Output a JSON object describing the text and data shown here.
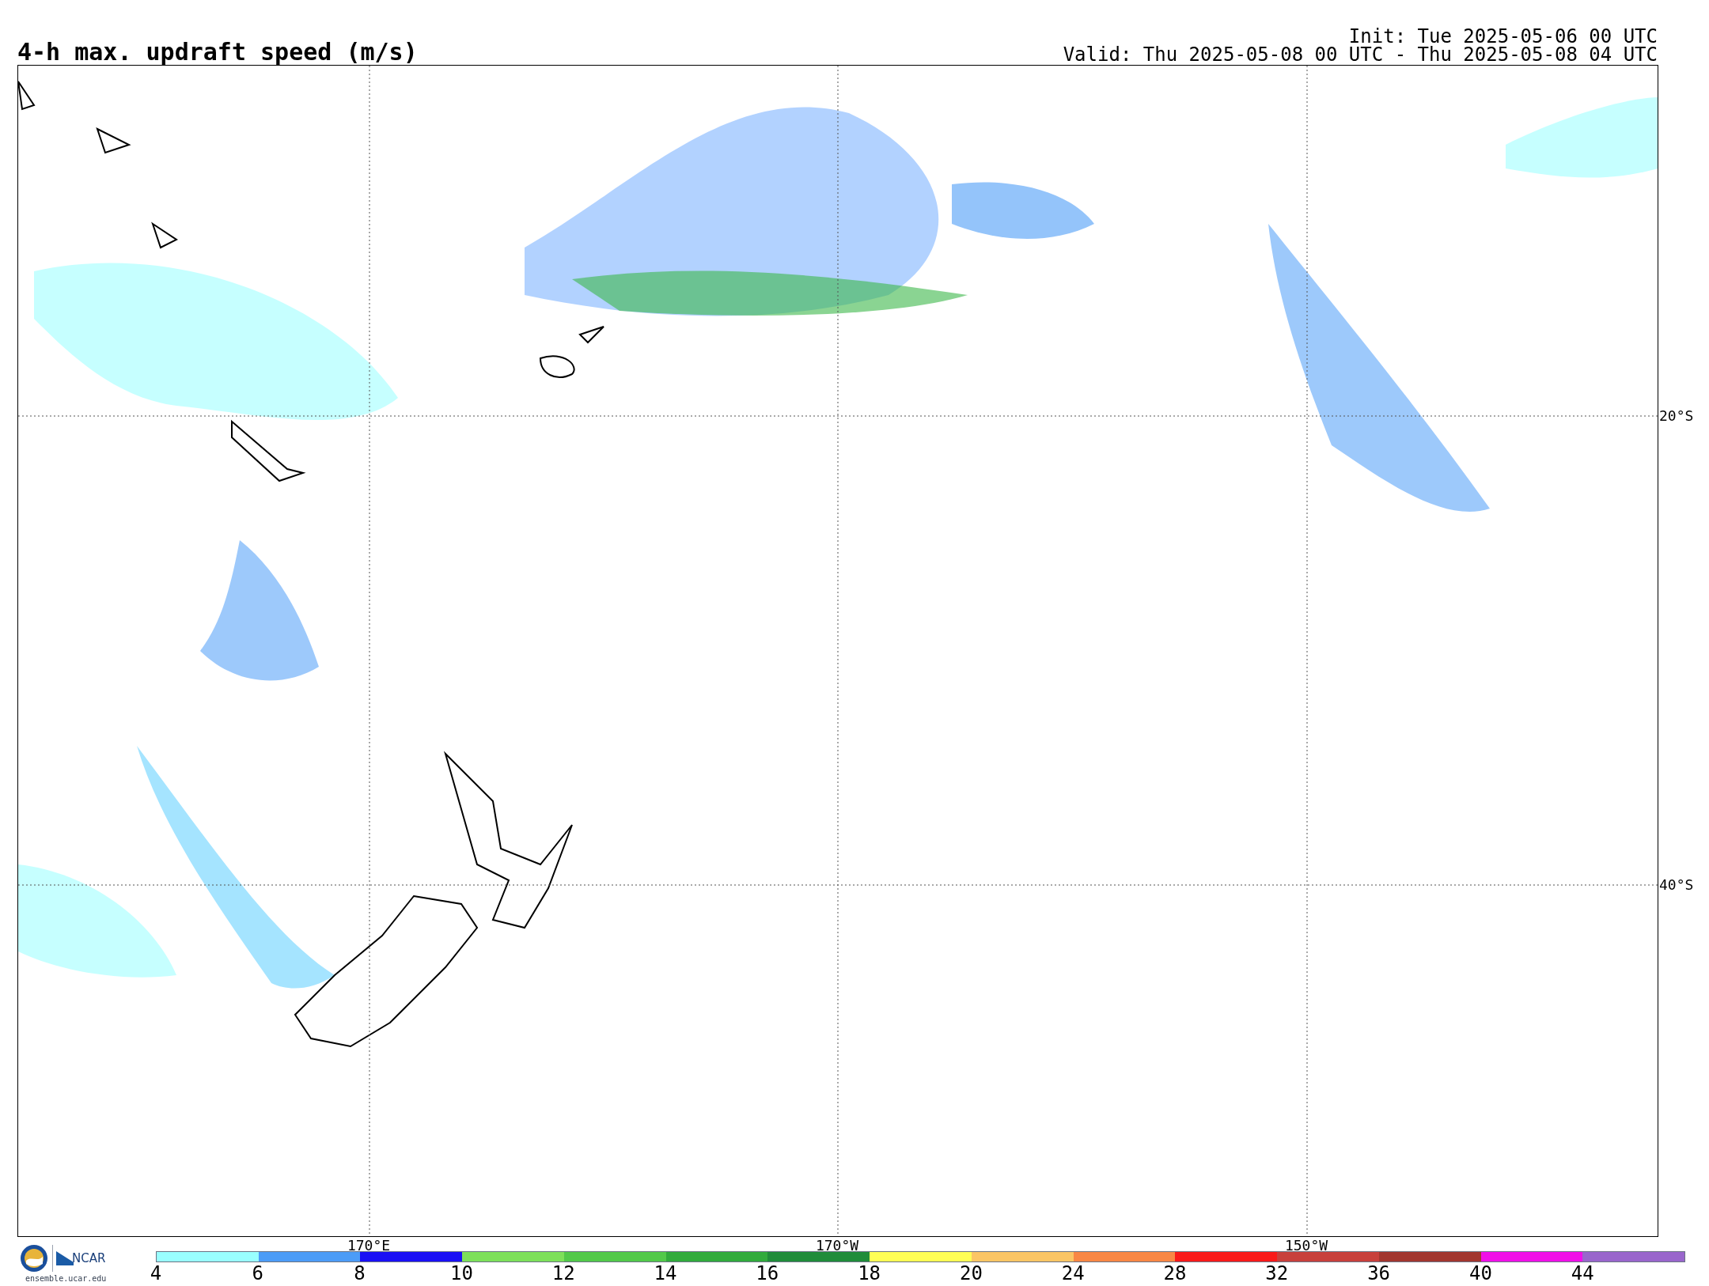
{
  "title": "4-h max. updraft speed (m/s)",
  "init": "Init: Tue 2025-05-06 00 UTC",
  "valid": "Valid: Thu 2025-05-08 00 UTC - Thu 2025-05-08 04 UTC",
  "map": {
    "lat_labels": [
      "20°S",
      "40°S"
    ],
    "lon_labels": [
      "170°E",
      "170°W",
      "150°W"
    ]
  },
  "logo": {
    "name": "NCAR",
    "url": "ensemble.ucar.edu"
  },
  "colorbar": [
    {
      "label": "4",
      "color": "#99ffff"
    },
    {
      "label": "6",
      "color": "#4c9cf7"
    },
    {
      "label": "8",
      "color": "#1a10f5"
    },
    {
      "label": "10",
      "color": "#7de05a"
    },
    {
      "label": "12",
      "color": "#52c94a"
    },
    {
      "label": "14",
      "color": "#31ab3c"
    },
    {
      "label": "16",
      "color": "#208c3a"
    },
    {
      "label": "18",
      "color": "#ffff55"
    },
    {
      "label": "20",
      "color": "#fbc565"
    },
    {
      "label": "24",
      "color": "#f98745"
    },
    {
      "label": "28",
      "color": "#fa1a1a"
    },
    {
      "label": "32",
      "color": "#c8403c"
    },
    {
      "label": "36",
      "color": "#a23630"
    },
    {
      "label": "40",
      "color": "#f010e8"
    },
    {
      "label": "44",
      "color": "#9966cc"
    }
  ]
}
